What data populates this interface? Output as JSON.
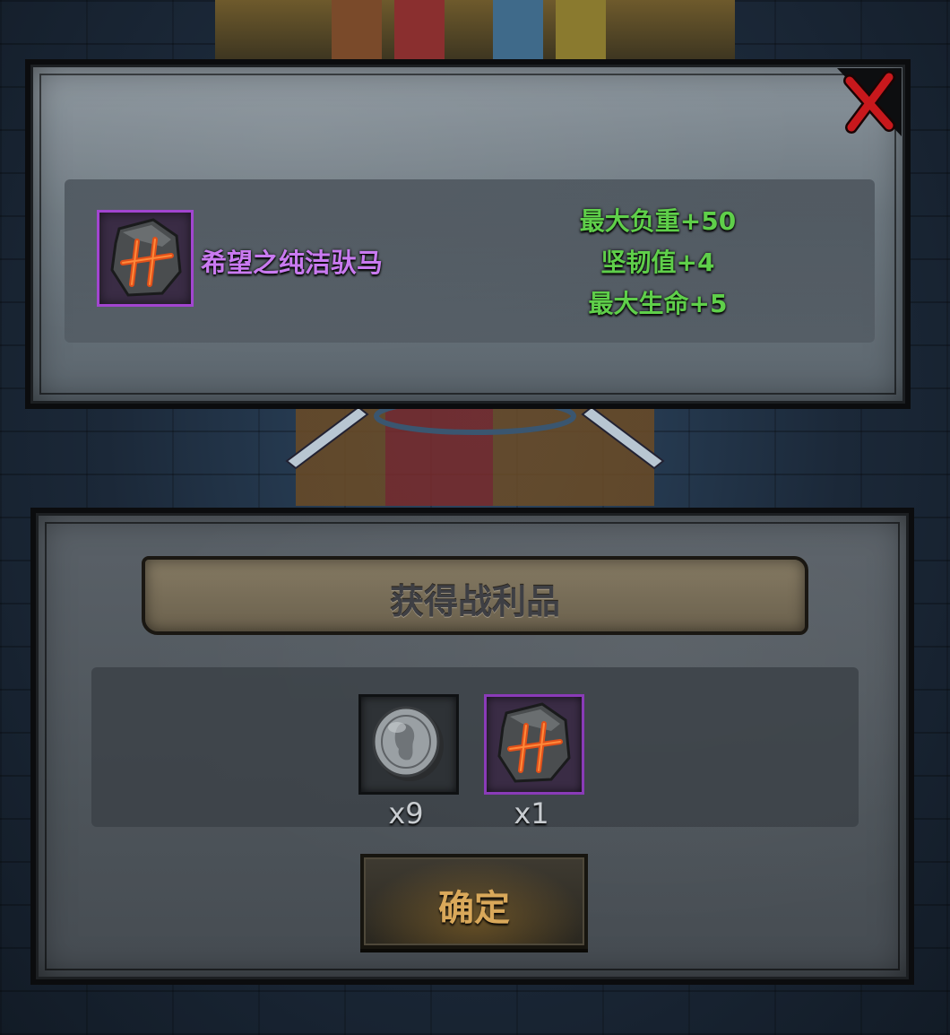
{
  "item_panel": {
    "item_name": "希望之纯洁驮马",
    "item_icon": "rune-stone-icon",
    "stats": [
      "最大负重+50",
      "坚韧值+4",
      "最大生命+5"
    ]
  },
  "loot_panel": {
    "title": "获得战利品",
    "loot": [
      {
        "icon": "silver-coin-icon",
        "count": "x9"
      },
      {
        "icon": "rune-stone-icon",
        "count": "x1"
      }
    ],
    "confirm_label": "确定"
  },
  "colors": {
    "item_name": "#c97af0",
    "stat": "#5fcf4a",
    "rare_border": "#a245d0",
    "close": "#c8181c",
    "confirm_text": "#d9a85a"
  }
}
